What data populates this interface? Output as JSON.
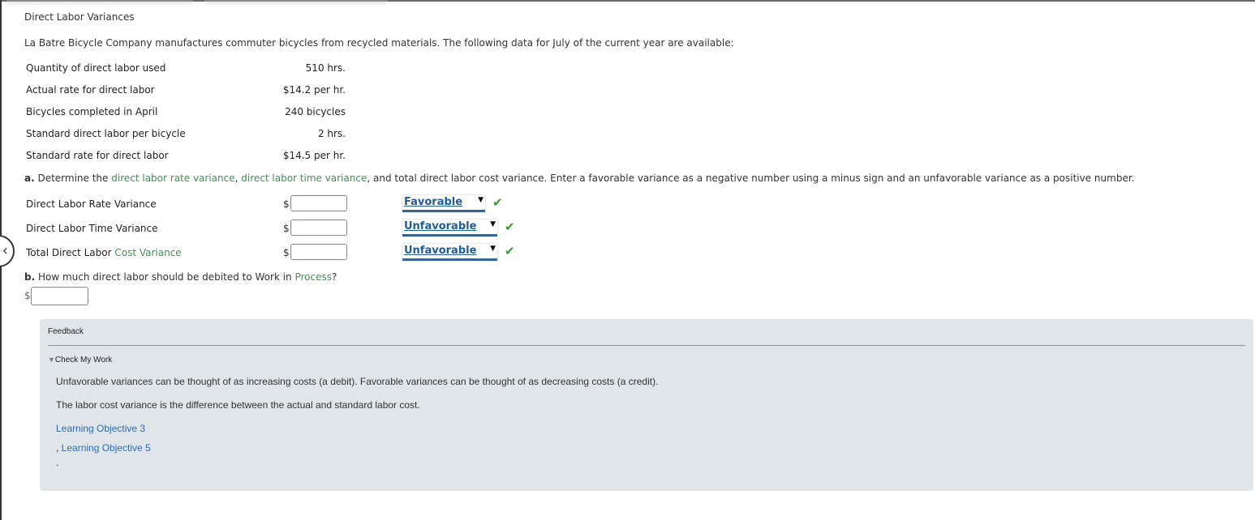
{
  "page": {
    "title": "Direct Labor Variances",
    "intro": "La Batre Bicycle Company manufactures commuter bicycles from recycled materials. The following data for July of the current year are available:"
  },
  "given_data": [
    {
      "label": "Quantity of direct labor used",
      "value": "510 hrs."
    },
    {
      "label": "Actual rate for direct labor",
      "value": "$14.2 per hr."
    },
    {
      "label": "Bicycles completed in April",
      "value": "240 bicycles"
    },
    {
      "label": "Standard direct labor per bicycle",
      "value": "2 hrs."
    },
    {
      "label": "Standard rate for direct labor",
      "value": "$14.5 per hr."
    }
  ],
  "part_a": {
    "letter": "a.",
    "text_1": " Determine the ",
    "link_1": "direct labor rate variance",
    "text_2": ", ",
    "link_2": "direct labor time variance",
    "text_3": ", and total direct labor cost variance. Enter a favorable variance as a negative number using a minus sign and an unfavorable variance as a positive number.",
    "rows": [
      {
        "label": "Direct Labor Rate Variance",
        "label_link": "",
        "currency": "$",
        "value": "",
        "selection": "Favorable",
        "status": "correct",
        "status_icon": "✔"
      },
      {
        "label": "Direct Labor Time Variance",
        "label_link": "",
        "currency": "$",
        "value": "",
        "selection": "Unfavorable",
        "status": "correct",
        "status_icon": "✔"
      },
      {
        "label": "Total Direct Labor ",
        "label_link": "Cost Variance",
        "currency": "$",
        "value": "",
        "selection": "Unfavorable",
        "status": "correct",
        "status_icon": "✔"
      }
    ]
  },
  "part_b": {
    "letter": "b.",
    "text": " How much direct labor should be debited to Work in ",
    "link": "Process",
    "suffix": "?",
    "currency": "$",
    "value": ""
  },
  "feedback": {
    "title": "Feedback",
    "section_label": "Check My Work",
    "toggle_icon": "▼",
    "paragraphs": [
      "Unfavorable variances can be thought of as increasing costs (a debit). Favorable variances can be thought of as decreasing costs (a credit).",
      "The labor cost variance is the difference between the actual and standard labor cost."
    ],
    "links": [
      "Learning Objective 3",
      "Learning Objective 5"
    ],
    "separator": ", ",
    "end_mark": "."
  },
  "colors": {
    "link_green": "#4a8c5c",
    "select_blue": "#1f5d99",
    "check_green": "#3a9a3a",
    "feedback_bg": "#dfe5e9",
    "feedback_link": "#2b6cb8"
  },
  "nav": {
    "collapse_icon": "‹"
  }
}
